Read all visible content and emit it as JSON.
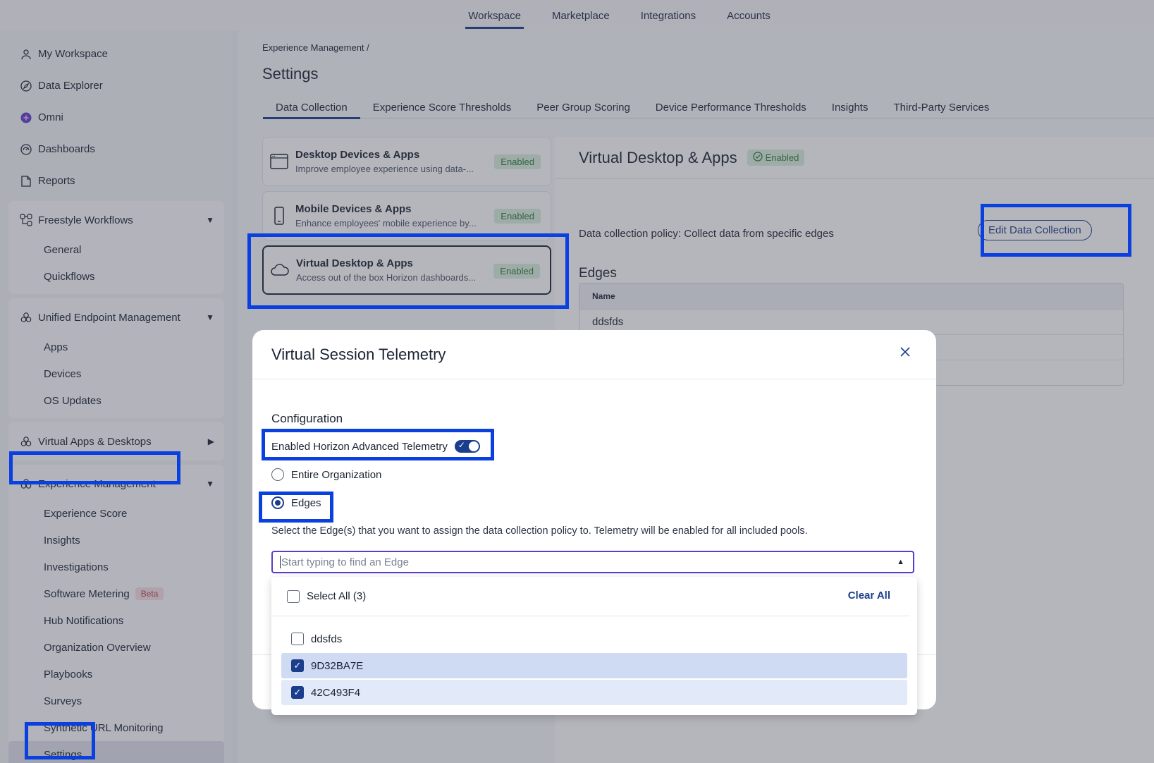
{
  "topnav": {
    "items": [
      "Workspace",
      "Marketplace",
      "Integrations",
      "Accounts"
    ]
  },
  "sidebar": {
    "top": [
      "My Workspace",
      "Data Explorer",
      "Omni",
      "Dashboards",
      "Reports"
    ],
    "groups": [
      {
        "label": "Freestyle Workflows",
        "items": [
          "General",
          "Quickflows"
        ]
      },
      {
        "label": "Unified Endpoint Management",
        "items": [
          "Apps",
          "Devices",
          "OS Updates"
        ]
      },
      {
        "label": "Virtual Apps & Desktops",
        "items": []
      },
      {
        "label": "Experience Management",
        "items": [
          "Experience Score",
          "Insights",
          "Investigations",
          "Software Metering",
          "Hub Notifications",
          "Organization Overview",
          "Playbooks",
          "Surveys",
          "Synthetic URL Monitoring",
          "Settings"
        ]
      }
    ],
    "beta": "Beta"
  },
  "main": {
    "breadcrumb": "Experience Management  /",
    "title": "Settings",
    "tabs": [
      "Data Collection",
      "Experience Score Thresholds",
      "Peer Group Scoring",
      "Device Performance Thresholds",
      "Insights",
      "Third-Party Services"
    ],
    "cards": [
      {
        "title": "Desktop Devices & Apps",
        "desc": "Improve employee experience using data-...",
        "badge": "Enabled"
      },
      {
        "title": "Mobile Devices & Apps",
        "desc": "Enhance employees' mobile experience by...",
        "badge": "Enabled"
      },
      {
        "title": "Virtual Desktop & Apps",
        "desc": "Access out of the box Horizon dashboards...",
        "badge": "Enabled"
      }
    ],
    "detail": {
      "title": "Virtual Desktop & Apps",
      "badge": "Enabled",
      "policy": "Data collection policy: Collect data from specific edges",
      "edit_button": "Edit Data Collection",
      "edges_title": "Edges",
      "table_header": "Name",
      "rows": [
        "ddsfds",
        "",
        ""
      ]
    }
  },
  "modal": {
    "title": "Virtual Session Telemetry",
    "config_title": "Configuration",
    "toggle_label": "Enabled Horizon Advanced Telemetry",
    "toggle_on": true,
    "radio_org": "Entire Organization",
    "radio_edges": "Edges",
    "selected_radio": "Edges",
    "help": "Select the Edge(s) that you want to assign the data collection policy to. Telemetry will be enabled for all included pools.",
    "placeholder": "Start typing to find an Edge"
  },
  "dropdown": {
    "select_all": "Select All  (3)",
    "clear_all": "Clear All",
    "items": [
      {
        "label": "ddsfds",
        "checked": false
      },
      {
        "label": "9D32BA7E",
        "checked": true
      },
      {
        "label": "42C493F4",
        "checked": true
      }
    ]
  },
  "colors": {
    "accent": "#1b3e8c",
    "annotation": "#0a3fe0",
    "enabled_bg": "#d8efdc"
  }
}
